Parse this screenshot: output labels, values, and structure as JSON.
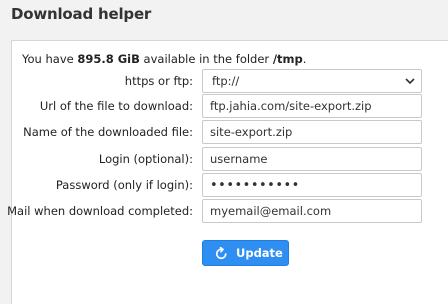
{
  "title": "Download helper",
  "info": {
    "prefix": "You have ",
    "space": "895.8 GiB",
    "middle": " available in the folder ",
    "folder": "/tmp",
    "suffix": "."
  },
  "form": {
    "protocol": {
      "label": "https or ftp:",
      "value": "ftp://"
    },
    "url": {
      "label": "Url of the file to download:",
      "value": "ftp.jahia.com/site-export.zip"
    },
    "filename": {
      "label": "Name of the downloaded file:",
      "value": "site-export.zip"
    },
    "login": {
      "label": "Login (optional):",
      "value": "username"
    },
    "password": {
      "label": "Password (only if login):",
      "value": "•••••••••••"
    },
    "mail": {
      "label": "Mail when download completed:",
      "value": "myemail@email.com"
    }
  },
  "button": {
    "label": "Update",
    "icon": "refresh-icon",
    "color": "#2e8ef1"
  }
}
